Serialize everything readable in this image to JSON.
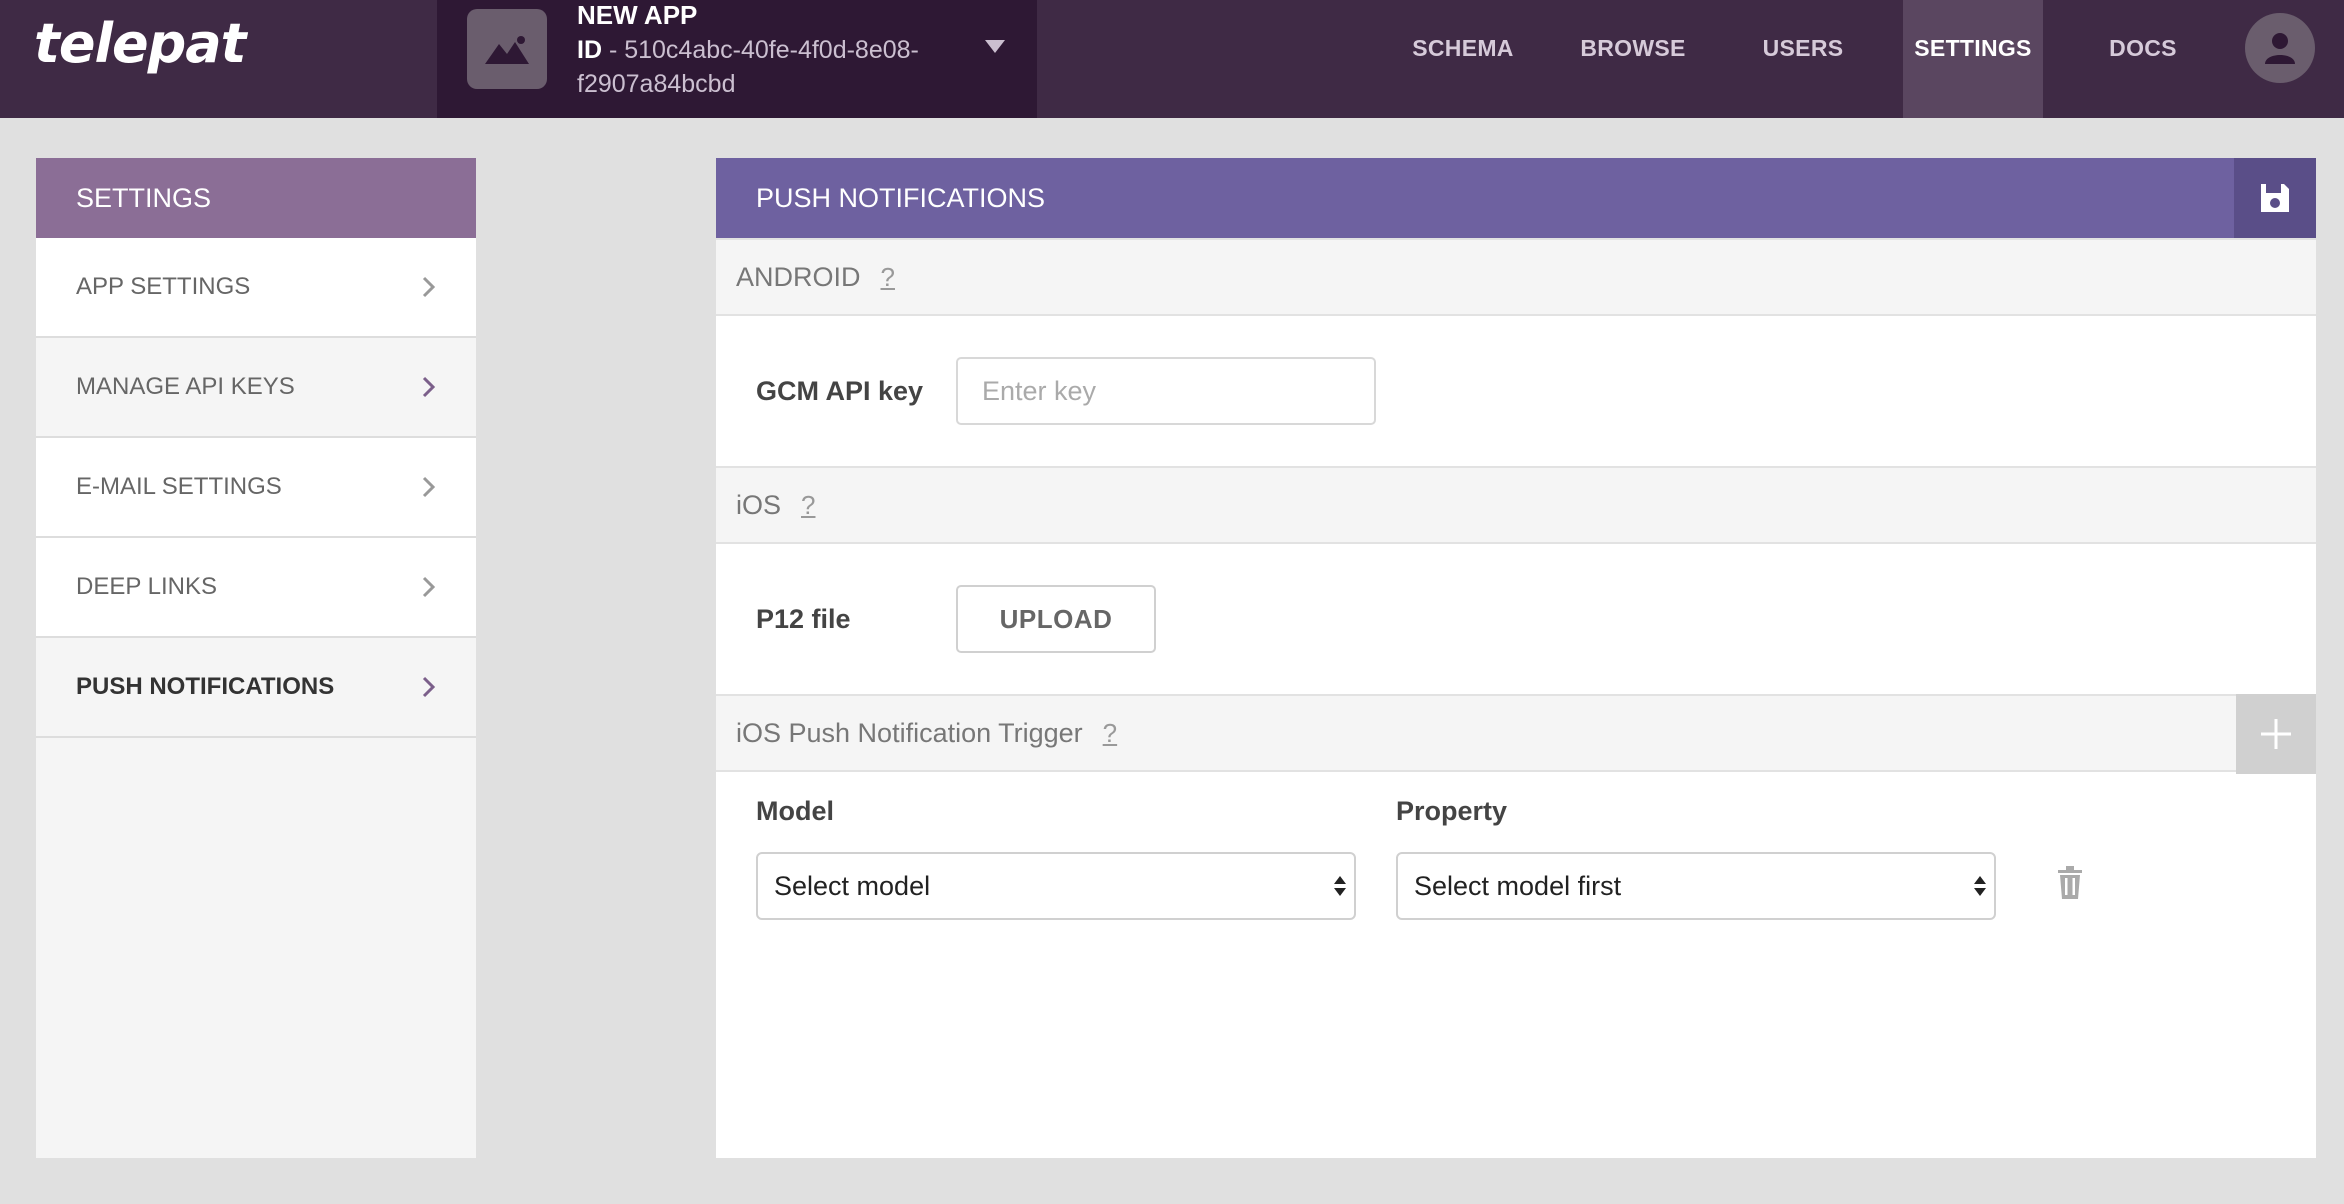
{
  "topbar": {
    "logo": "telepat",
    "app": {
      "name": "NEW APP",
      "id_label": "ID",
      "id_value": " - 510c4abc-40fe-4f0d-8e08-f2907a84bcbd"
    },
    "nav": [
      {
        "label": "SCHEMA",
        "active": false
      },
      {
        "label": "BROWSE",
        "active": false
      },
      {
        "label": "USERS",
        "active": false
      },
      {
        "label": "SETTINGS",
        "active": true
      },
      {
        "label": "DOCS",
        "active": false
      }
    ]
  },
  "sidebar": {
    "title": "SETTINGS",
    "items": [
      {
        "label": "APP SETTINGS"
      },
      {
        "label": "MANAGE API KEYS"
      },
      {
        "label": "E-MAIL SETTINGS"
      },
      {
        "label": "DEEP LINKS"
      },
      {
        "label": "PUSH NOTIFICATIONS",
        "active": true
      }
    ]
  },
  "panel": {
    "title": "PUSH NOTIFICATIONS",
    "android": {
      "title": "ANDROID",
      "help": "?",
      "gcm_label": "GCM API key",
      "gcm_placeholder": "Enter key",
      "gcm_value": ""
    },
    "ios": {
      "title": "iOS",
      "help": "?",
      "p12_label": "P12 file",
      "upload_label": "UPLOAD"
    },
    "trigger": {
      "title": "iOS Push Notification Trigger",
      "help": "?",
      "model_label": "Model",
      "property_label": "Property",
      "model_selected": "Select model",
      "property_selected": "Select model first"
    }
  },
  "colors": {
    "topbar": "#3f2a45",
    "app_selector": "#2e1834",
    "sidebar_header": "#8b6e96",
    "panel_header": "#6e61a0",
    "active_chevron": "#7b5f8a"
  }
}
